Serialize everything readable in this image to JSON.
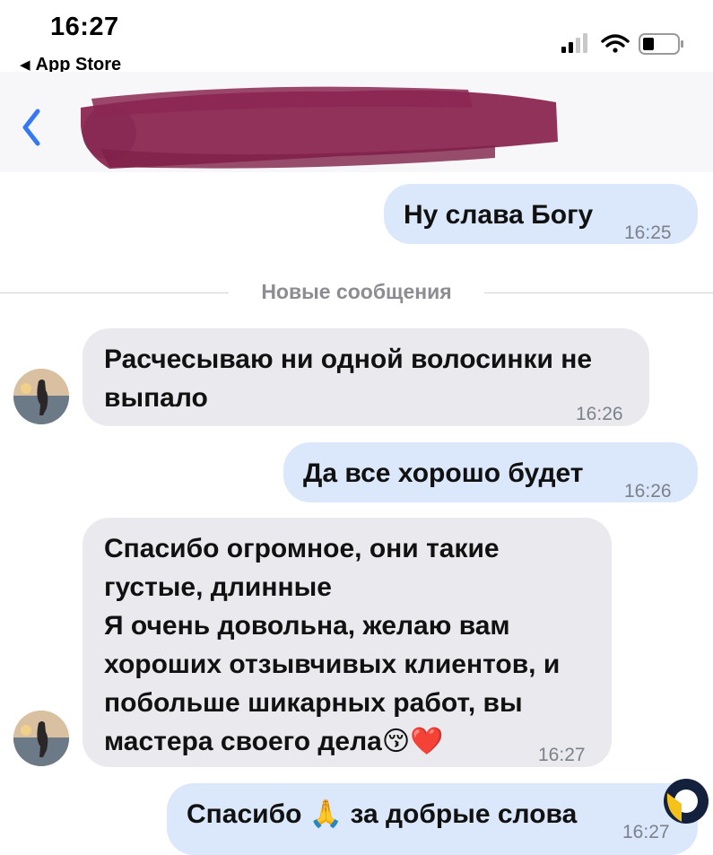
{
  "status_bar": {
    "time": "16:27",
    "back_app": "App Store",
    "back_arrow_icon": "small-left-triangle-icon",
    "signal_icon": "cellular-signal-icon",
    "wifi_icon": "wifi-icon",
    "battery_icon": "battery-icon"
  },
  "header": {
    "back_icon": "chevron-left-icon",
    "redacted_color": "#8b2752"
  },
  "divider": {
    "label": "Новые сообщения"
  },
  "messages": [
    {
      "direction": "outgoing",
      "text": "Ну слава Богу",
      "time": "16:25"
    },
    {
      "direction": "incoming",
      "text": "Расчесываю ни одной волосинки не\nвыпало",
      "time": "16:26"
    },
    {
      "direction": "outgoing",
      "text": "Да все хорошо будет",
      "time": "16:26"
    },
    {
      "direction": "incoming",
      "text": "Спасибо огромное, они такие\nгустые, длинные\nЯ очень довольна, желаю вам\nхороших отзывчивых клиентов, и\nпобольше шикарных работ, вы\nмастера своего дела😚❤️",
      "time": "16:27"
    },
    {
      "direction": "outgoing",
      "text": "Спасибо 🙏 за добрые слова",
      "time": "16:27"
    }
  ],
  "colors": {
    "outgoing_bubble": "#dbe8fb",
    "incoming_bubble": "#eaeaee",
    "accent": "#3478f6"
  }
}
